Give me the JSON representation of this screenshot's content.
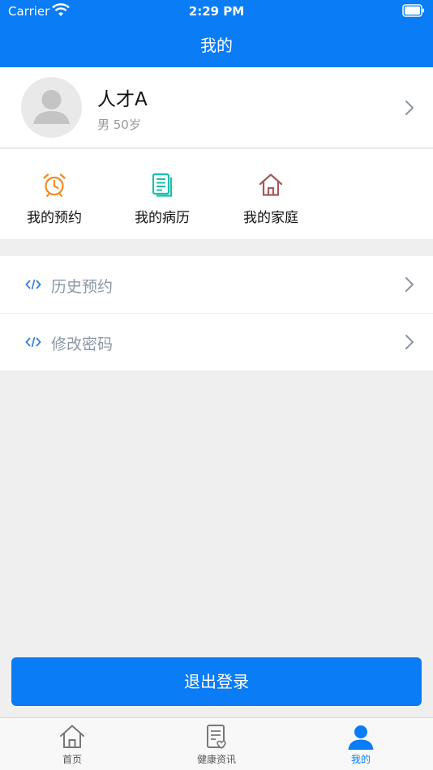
{
  "status_bar": {
    "carrier": "Carrier",
    "time": "2:29 PM"
  },
  "nav": {
    "title": "我的"
  },
  "profile": {
    "name": "人才A",
    "gender_age": "男  50岁"
  },
  "quick_actions": [
    {
      "label": "我的预约",
      "icon": "alarm-clock-icon",
      "color": "#f08a24"
    },
    {
      "label": "我的病历",
      "icon": "document-icon",
      "color": "#1bbfae"
    },
    {
      "label": "我的家庭",
      "icon": "house-icon",
      "color": "#a55a5a"
    }
  ],
  "menu": [
    {
      "label": "历史预约",
      "icon": "code-icon"
    },
    {
      "label": "修改密码",
      "icon": "code-icon"
    }
  ],
  "logout_label": "退出登录",
  "tabs": [
    {
      "label": "首页",
      "icon": "home-icon",
      "active": false
    },
    {
      "label": "健康资讯",
      "icon": "health-news-icon",
      "active": false
    },
    {
      "label": "我的",
      "icon": "person-icon",
      "active": true
    }
  ],
  "colors": {
    "primary": "#0a7cf6",
    "background": "#efefef",
    "menu_text": "#8b97a5"
  }
}
